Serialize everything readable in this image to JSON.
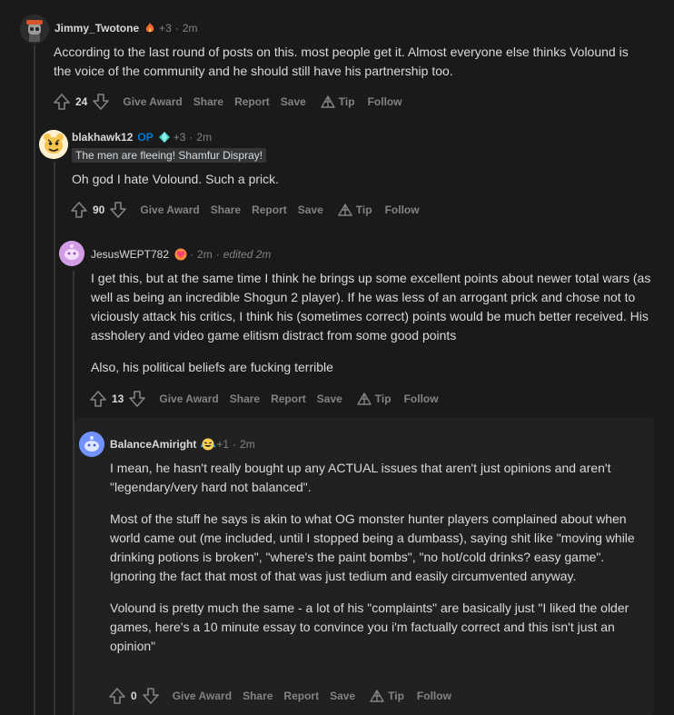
{
  "comments": [
    {
      "username": "Jimmy_Twotone",
      "op_tag": "",
      "karma_badge": "+3",
      "age": "2m",
      "edited": "",
      "flair": "",
      "body": [
        "According to the last round of posts on this. most people get it. Almost everyone else thinks Volound is the voice of the community and he should still have his partnership too."
      ],
      "score": "24",
      "actions": {
        "give_award": "Give Award",
        "share": "Share",
        "report": "Report",
        "save": "Save",
        "tip": "Tip",
        "follow": "Follow"
      },
      "avatar_color": "#3a3a3c"
    },
    {
      "username": "blakhawk12",
      "op_tag": "OP",
      "karma_badge": "+3",
      "age": "2m",
      "edited": "",
      "flair": "The men are fleeing! Shamfur Dispray!",
      "body": [
        "Oh god I hate Volound. Such a prick."
      ],
      "score": "90",
      "actions": {
        "give_award": "Give Award",
        "share": "Share",
        "report": "Report",
        "save": "Save",
        "tip": "Tip",
        "follow": "Follow"
      },
      "avatar_color": "#f6c44f"
    },
    {
      "username": "JesusWEPT782",
      "op_tag": "",
      "karma_badge": "",
      "age": "2m",
      "edited": "edited 2m",
      "flair": "",
      "body": [
        "I get this, but at the same time I think he brings up some excellent points about newer total wars (as well as being an incredible Shogun 2 player). If he was less of an arrogant prick and chose not to viciously attack his critics, I think his (sometimes correct) points would be much better received. His assholery and video game elitism distract from some good points",
        "Also, his political beliefs are fucking terrible"
      ],
      "score": "13",
      "actions": {
        "give_award": "Give Award",
        "share": "Share",
        "report": "Report",
        "save": "Save",
        "tip": "Tip",
        "follow": "Follow"
      },
      "avatar_color": "#d29ce6"
    },
    {
      "username": "BalanceAmiright",
      "op_tag": "",
      "karma_badge": "+1",
      "age": "2m",
      "edited": "",
      "flair": "",
      "body": [
        "I mean, he hasn't really bought up any ACTUAL issues that aren't just opinions and aren't \"legendary/very hard not balanced\".",
        "Most of the stuff he says is akin to what OG monster hunter players complained about when world came out (me included, until I stopped being a dumbass), saying shit like \"moving while drinking potions is broken\", \"where's the paint bombs\", \"no hot/cold drinks? easy game\".\nIgnoring the fact that most of that was just tedium and easily circumvented anyway.",
        "Volound is pretty much the same - a lot of his \"complaints\" are basically just \"I liked the older games, here's a 10 minute essay to convince you i'm factually correct and this isn't just an opinion\""
      ],
      "score": "0",
      "actions": {
        "give_award": "Give Award",
        "share": "Share",
        "report": "Report",
        "save": "Save",
        "tip": "Tip",
        "follow": "Follow"
      },
      "avatar_color": "#7193ff"
    }
  ],
  "colors": {
    "background": "#1a1a1b",
    "panel": "#212122",
    "text": "#d7dadc",
    "muted": "#818384",
    "op_blue": "#0079d3",
    "thread_line": "#343536"
  }
}
